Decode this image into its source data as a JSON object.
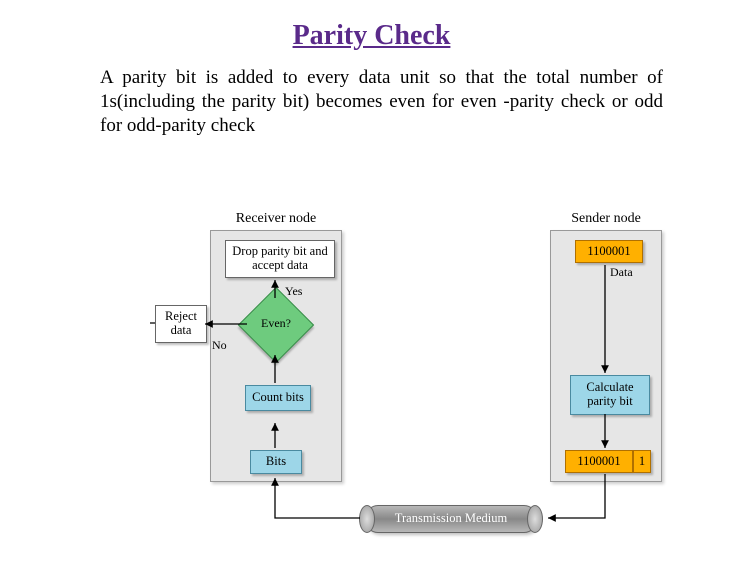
{
  "title": "Parity Check",
  "description": "A parity bit is added to every data unit so that the total number of 1s(including the parity bit) becomes even for even -parity check or odd for odd-parity check",
  "receiver": {
    "label": "Receiver node",
    "drop": "Drop parity bit and accept data",
    "reject": "Reject data",
    "decision": "Even?",
    "yes": "Yes",
    "no": "No",
    "count": "Count bits",
    "bits": "Bits"
  },
  "sender": {
    "label": "Sender node",
    "data_value": "1100001",
    "data_label": "Data",
    "calc": "Calculate parity bit",
    "out_value": "1100001",
    "out_parity": "1"
  },
  "medium": "Transmission Medium"
}
